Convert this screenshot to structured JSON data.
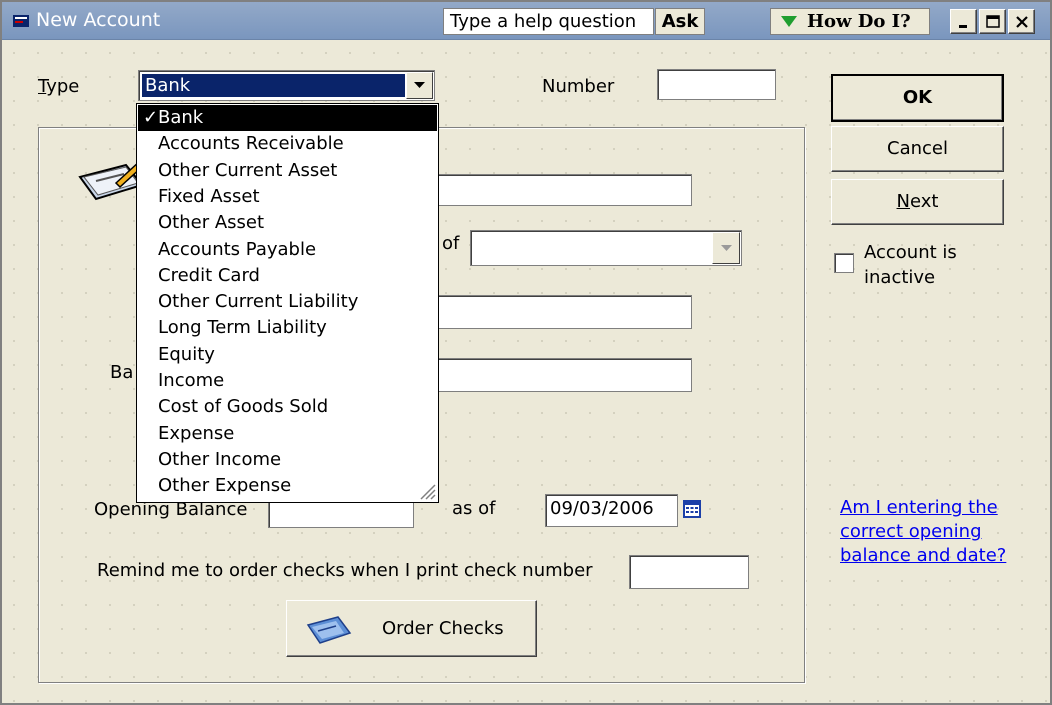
{
  "window": {
    "title": "New Account"
  },
  "toolbar": {
    "help_placeholder": "Type a help question",
    "ask_label": "Ask",
    "howdoi_label": "How Do I?"
  },
  "form": {
    "type_label": "Type",
    "type_value": "Bank",
    "number_label": "Number",
    "number_value": "",
    "partial_of_label": "of",
    "partial_ba_label": "Ba",
    "opening_balance_label": "Opening Balance",
    "as_of_label": "as of",
    "as_of_date": "09/03/2006",
    "remind_label": "Remind me to order checks when I print check number",
    "order_checks_label": "Order Checks"
  },
  "side": {
    "ok_label": "OK",
    "cancel_label": "Cancel",
    "next_label": "Next",
    "inactive_label_1": "Account is",
    "inactive_label_2": "inactive",
    "help_link_1": "Am I entering the",
    "help_link_2": "correct opening",
    "help_link_3": "balance and date?"
  },
  "dropdown": {
    "options": [
      "Bank",
      "Accounts Receivable",
      "Other Current Asset",
      "Fixed Asset",
      "Other Asset",
      "Accounts Payable",
      "Credit Card",
      "Other Current Liability",
      "Long Term Liability",
      "Equity",
      "Income",
      "Cost of Goods Sold",
      "Expense",
      "Other Income",
      "Other Expense"
    ],
    "selected_index": 0,
    "check_mark": "✓"
  },
  "colors": {
    "selection": "#0a246a",
    "link": "#0000ee",
    "titlebar": "#7a96be"
  }
}
